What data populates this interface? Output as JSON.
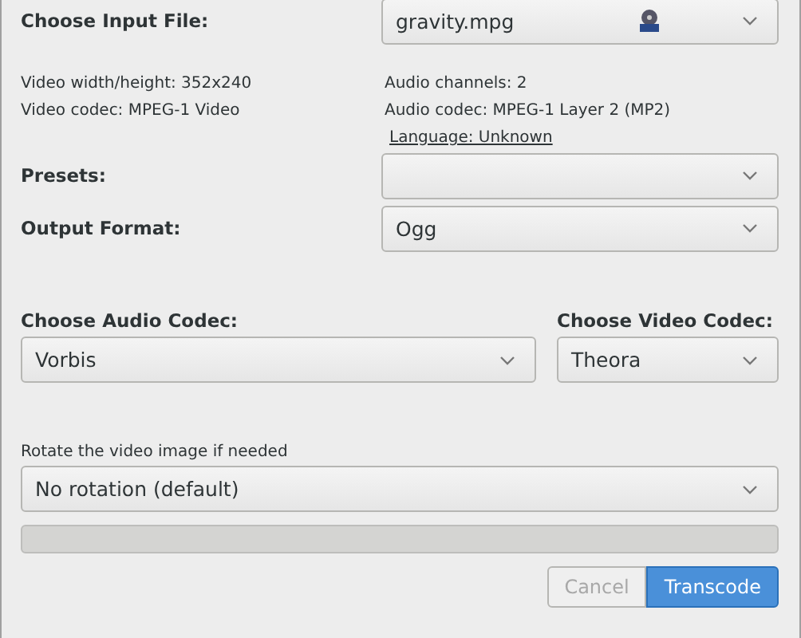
{
  "input_file": {
    "label": "Choose Input File:",
    "value": "gravity.mpg"
  },
  "info_left": [
    "Video width/height: 352x240",
    "Video codec: MPEG-1 Video"
  ],
  "info_right": [
    "Audio channels: 2",
    "Audio codec: MPEG-1 Layer 2 (MP2)"
  ],
  "language_link": "Language: Unknown",
  "presets": {
    "label": "Presets:"
  },
  "output_format": {
    "label": "Output Format:",
    "value": "Ogg"
  },
  "audio_codec": {
    "label": "Choose Audio Codec:",
    "value": "Vorbis"
  },
  "video_codec": {
    "label": "Choose Video Codec:",
    "value": "Theora"
  },
  "rotation": {
    "label": "Rotate the video image if needed",
    "value": "No rotation (default)"
  },
  "progress": {
    "level": 0
  },
  "buttons": [
    {
      "label": "Cancel",
      "kind": "secondary",
      "disabled": true
    },
    {
      "label": "Transcode",
      "kind": "primary",
      "disabled": false
    }
  ]
}
